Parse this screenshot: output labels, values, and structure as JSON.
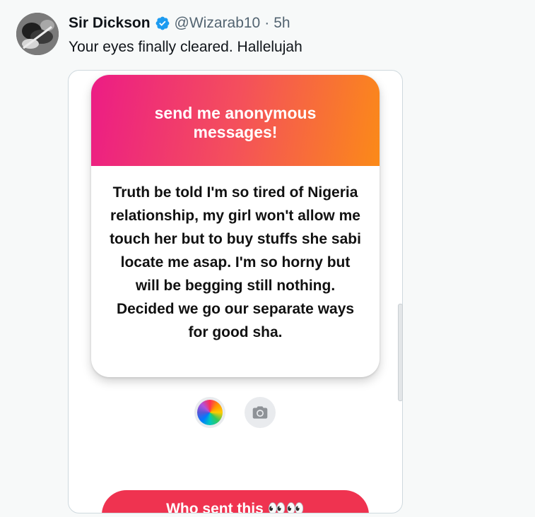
{
  "tweet": {
    "author_name": "Sir Dickson",
    "handle": "@Wizarab10",
    "separator": "·",
    "time": "5h",
    "text": "Your eyes finally cleared. Hallelujah",
    "verified_color": "#1d9bf0"
  },
  "media": {
    "card_title": "send me anonymous messages!",
    "card_message": "Truth be told I'm so tired of Nigeria relationship, my girl won't allow me touch her but to buy stuffs she sabi locate me asap. I'm so horny but will be begging still nothing. Decided we go our separate ways for good sha.",
    "gradient_colors": [
      "#ec1c85",
      "#fb8a18"
    ],
    "color_button_icon": "color-wheel-icon",
    "camera_button_icon": "camera-icon",
    "who_sent_label": "Who sent this 👀👀",
    "who_sent_color": "#ef3350"
  }
}
